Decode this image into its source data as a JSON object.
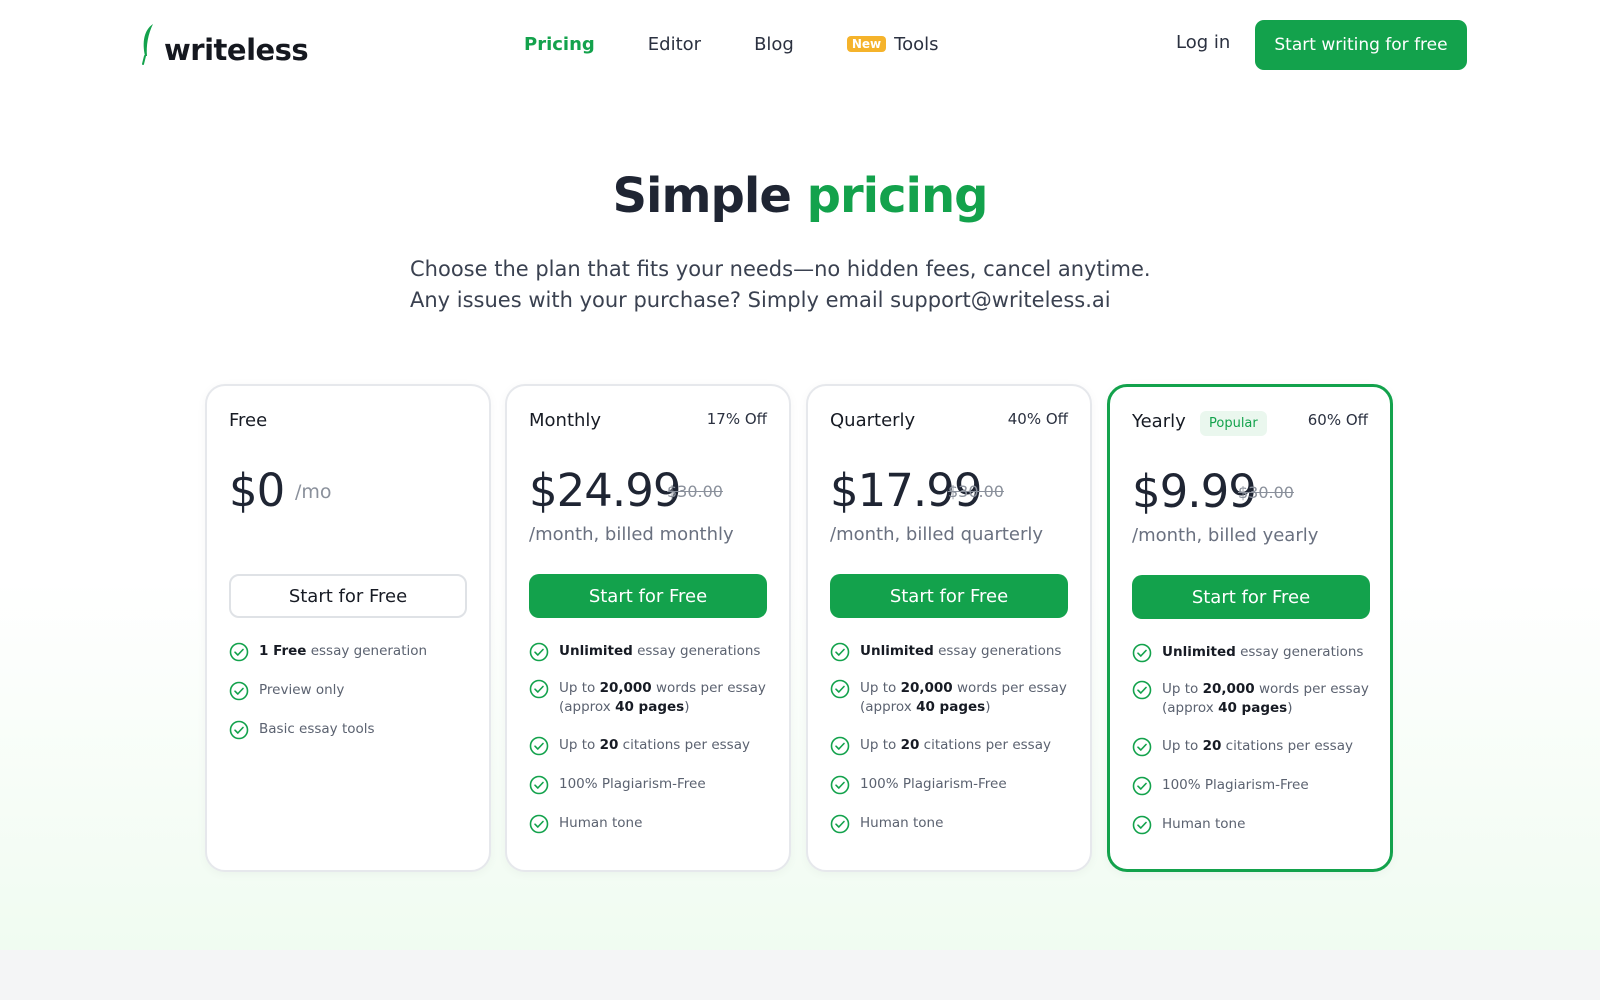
{
  "nav": {
    "logo": "writeless",
    "links": [
      {
        "label": "Pricing",
        "active": true
      },
      {
        "label": "Editor"
      },
      {
        "label": "Blog"
      },
      {
        "label": "Tools",
        "badge": "New"
      }
    ],
    "login": "Log in",
    "cta": "Start writing for free"
  },
  "hero": {
    "title_a": "Simple",
    "title_b": "pricing",
    "sub1": "Choose the plan that fits your needs—no hidden fees, cancel anytime.",
    "sub2": "Any issues with your purchase? Simply email support@writeless.ai"
  },
  "plans": [
    {
      "name": "Free",
      "price": "$0",
      "per": "/mo",
      "button": "Start for Free",
      "features": [
        [
          "1 Free",
          " essay generation"
        ],
        [
          "",
          "Preview only"
        ],
        [
          "",
          "Basic essay tools"
        ]
      ]
    },
    {
      "name": "Monthly",
      "discount": "17% Off",
      "price": "$24.99",
      "old": "$30.00",
      "billing": "/month, billed monthly",
      "button": "Start for Free",
      "f": {
        "u": "Unlimited",
        "u2": " essay generations",
        "w1": "Up to ",
        "w2": "20,000",
        "w3": " words per essay",
        "w4": "(approx ",
        "w5": "40 pages",
        "w6": ")",
        "c1": "Up to ",
        "c2": "20",
        "c3": " citations per essay",
        "p": "100% Plagiarism-Free",
        "h": "Human tone"
      }
    },
    {
      "name": "Quarterly",
      "discount": "40% Off",
      "price": "$17.99",
      "old": "$30.00",
      "billing": "/month, billed quarterly",
      "button": "Start for Free",
      "f": {
        "u": "Unlimited",
        "u2": " essay generations",
        "w1": "Up to ",
        "w2": "20,000",
        "w3": " words per essay",
        "w4": "(approx ",
        "w5": "40 pages",
        "w6": ")",
        "c1": "Up to ",
        "c2": "20",
        "c3": " citations per essay",
        "p": "100% Plagiarism-Free",
        "h": "Human tone"
      }
    },
    {
      "name": "Yearly",
      "badge": "Popular",
      "discount": "60% Off",
      "price": "$9.99",
      "old": "$30.00",
      "billing": "/month, billed yearly",
      "button": "Start for Free",
      "f": {
        "u": "Unlimited",
        "u2": " essay generations",
        "w1": "Up to ",
        "w2": "20,000",
        "w3": " words per essay",
        "w4": "(approx ",
        "w5": "40 pages",
        "w6": ")",
        "c1": "Up to ",
        "c2": "20",
        "c3": " citations per essay",
        "p": "100% Plagiarism-Free",
        "h": "Human tone"
      }
    }
  ],
  "colors": {
    "accent": "#13a24c",
    "badge": "#f5b32b"
  }
}
